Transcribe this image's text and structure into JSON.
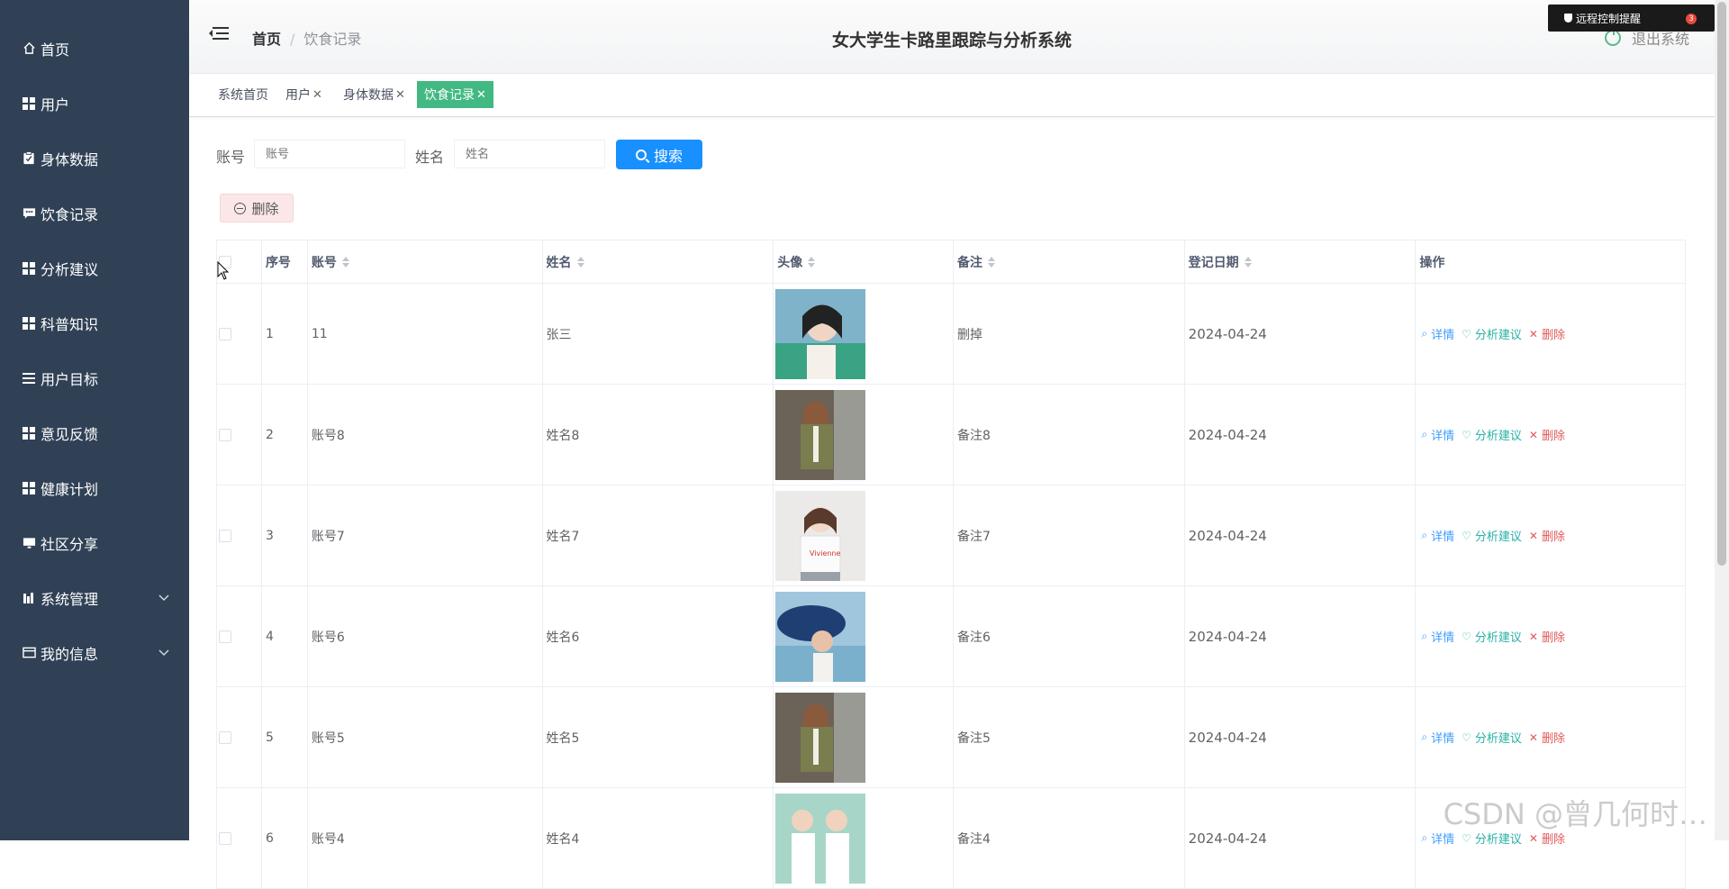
{
  "sidebar": {
    "items": [
      {
        "label": "首页",
        "icon": "home-icon"
      },
      {
        "label": "用户",
        "icon": "grid-icon"
      },
      {
        "label": "身体数据",
        "icon": "clipboard-icon"
      },
      {
        "label": "饮食记录",
        "icon": "message-icon"
      },
      {
        "label": "分析建议",
        "icon": "grid-icon"
      },
      {
        "label": "科普知识",
        "icon": "grid-icon"
      },
      {
        "label": "用户目标",
        "icon": "list-icon"
      },
      {
        "label": "意见反馈",
        "icon": "grid-icon"
      },
      {
        "label": "健康计划",
        "icon": "grid-icon"
      },
      {
        "label": "社区分享",
        "icon": "monitor-icon"
      },
      {
        "label": "系统管理",
        "icon": "chart-icon"
      },
      {
        "label": "我的信息",
        "icon": "card-icon"
      }
    ]
  },
  "header": {
    "breadcrumb_home": "首页",
    "breadcrumb_sep": "/",
    "breadcrumb_current": "饮食记录",
    "title": "女大学生卡路里跟踪与分析系统",
    "logout": "退出系统"
  },
  "remote_notice": {
    "label": "远程控制提醒",
    "count": "3"
  },
  "tags": [
    {
      "label": "系统首页"
    },
    {
      "label": "用户",
      "closable": true
    },
    {
      "label": "身体数据",
      "closable": true
    },
    {
      "label": "饮食记录",
      "closable": true,
      "active": true
    }
  ],
  "search": {
    "account_label": "账号",
    "account_placeholder": "账号",
    "name_label": "姓名",
    "name_placeholder": "姓名",
    "search_button": "搜索"
  },
  "toolbar": {
    "delete_button": "删除"
  },
  "table": {
    "columns": [
      "序号",
      "账号",
      "姓名",
      "头像",
      "备注",
      "登记日期",
      "操作"
    ],
    "rows": [
      {
        "idx": "1",
        "account": "11",
        "name": "张三",
        "note": "删掉",
        "date": "2024-04-24"
      },
      {
        "idx": "2",
        "account": "账号8",
        "name": "姓名8",
        "note": "备注8",
        "date": "2024-04-24"
      },
      {
        "idx": "3",
        "account": "账号7",
        "name": "姓名7",
        "note": "备注7",
        "date": "2024-04-24"
      },
      {
        "idx": "4",
        "account": "账号6",
        "name": "姓名6",
        "note": "备注6",
        "date": "2024-04-24"
      },
      {
        "idx": "5",
        "account": "账号5",
        "name": "姓名5",
        "note": "备注5",
        "date": "2024-04-24"
      },
      {
        "idx": "6",
        "account": "账号4",
        "name": "姓名4",
        "note": "备注4",
        "date": "2024-04-24"
      }
    ],
    "ops": {
      "detail": "详情",
      "analyze": "分析建议",
      "delete": "删除"
    }
  },
  "watermark": "CSDN @曾几何时…",
  "colors": {
    "sidebar_bg": "#304156",
    "active_tag": "#42b983",
    "primary": "#1890ff",
    "danger": "#e05a5a"
  }
}
